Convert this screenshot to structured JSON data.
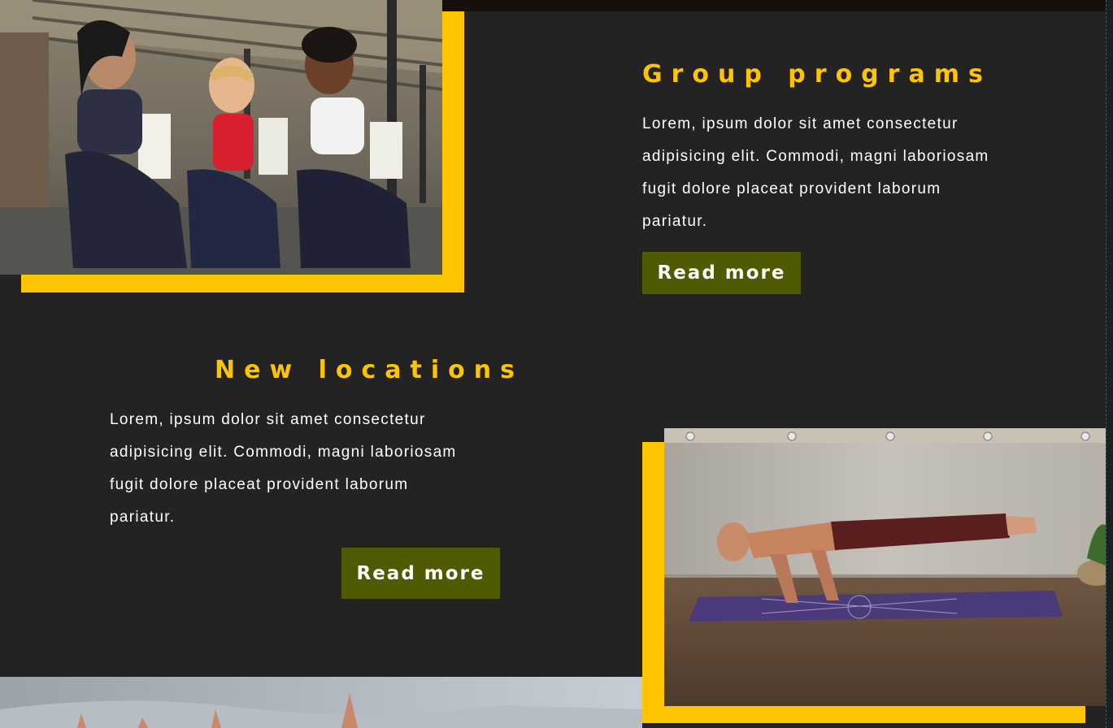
{
  "sections": [
    {
      "title": "Group programs",
      "body": "Lorem, ipsum dolor sit amet consectetur adipisicing elit. Commodi, magni laboriosam fugit dolore placeat provident laborum pariatur.",
      "button_label": "Read more",
      "image_subject": "three-women-kneeling-in-gym"
    },
    {
      "title": "New locations",
      "body": "Lorem, ipsum dolor sit amet consectetur adipisicing elit. Commodi, magni laboriosam fugit dolore placeat provident laborum pariatur.",
      "button_label": "Read more",
      "image_subject": "man-doing-yoga-arm-balance-on-mat"
    }
  ],
  "colors": {
    "background": "#232323",
    "accent_gold": "#ffc400",
    "button_green": "#505a00",
    "text": "#ffffff"
  }
}
